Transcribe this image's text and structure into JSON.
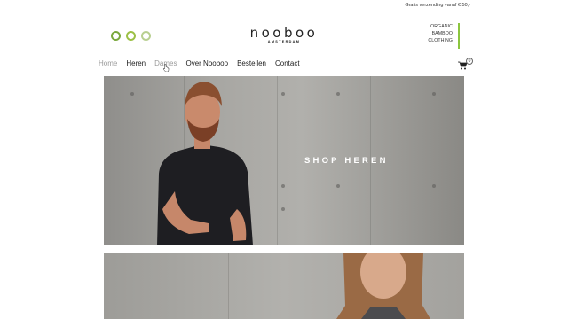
{
  "topbar": {
    "shipping_text": "Gratis verzending vanaf € 50,-"
  },
  "brand": {
    "name": "nooboo",
    "sub": "AMSTERDAM",
    "tagline": [
      "ORGANIC",
      "BAMBOO",
      "CLOTHING"
    ]
  },
  "nav": {
    "items": [
      "Home",
      "Heren",
      "Dames",
      "Over Nooboo",
      "Bestellen",
      "Contact"
    ]
  },
  "cart": {
    "count": "0"
  },
  "hero": {
    "cta": "SHOP HEREN"
  },
  "colors": {
    "accent_green": "#8cc63f",
    "circle_1": "#7aa83d",
    "circle_2": "#9cc046",
    "circle_3": "#b8cf90"
  }
}
